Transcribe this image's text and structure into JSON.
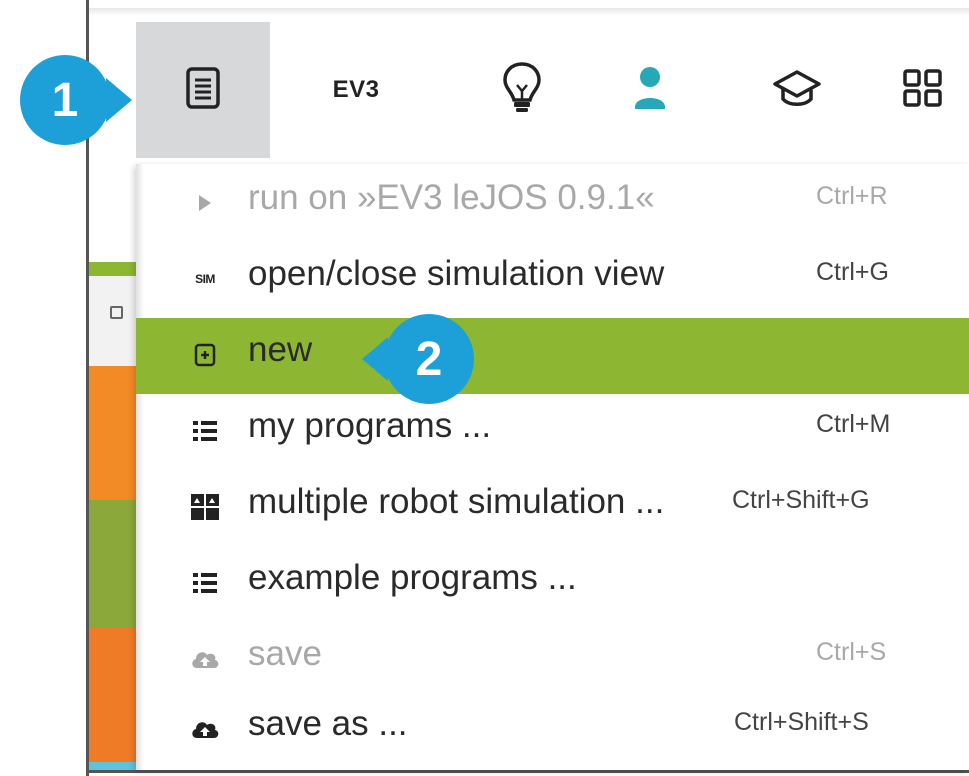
{
  "callouts": {
    "step1": "1",
    "step2": "2"
  },
  "toolbar": {
    "ev3_label": "EV3",
    "icons": [
      "program-menu-icon",
      "lightbulb-icon",
      "user-icon",
      "graduation-cap-icon",
      "grid-icon"
    ]
  },
  "menu": {
    "items": [
      {
        "icon": "play-icon",
        "label": "run on »EV3 leJOS 0.9.1«",
        "shortcut": "Ctrl+R",
        "disabled": true
      },
      {
        "icon": "sim-icon",
        "badge": "SIM",
        "label": "open/close simulation view",
        "shortcut": "Ctrl+G",
        "disabled": false
      },
      {
        "icon": "new-file-icon",
        "label": "new",
        "shortcut": "",
        "disabled": false,
        "highlighted": true
      },
      {
        "icon": "list-icon",
        "label": "my programs ...",
        "shortcut": "Ctrl+M",
        "disabled": false
      },
      {
        "icon": "grid-squares-icon",
        "label": "multiple robot simulation ...",
        "shortcut": "Ctrl+Shift+G",
        "disabled": false
      },
      {
        "icon": "list-icon",
        "label": "example programs ...",
        "shortcut": "",
        "disabled": false
      },
      {
        "icon": "cloud-upload-icon",
        "label": "save",
        "shortcut": "Ctrl+S",
        "disabled": true
      },
      {
        "icon": "cloud-upload-icon",
        "label": "save as ...",
        "shortcut": "Ctrl+Shift+S",
        "disabled": false
      }
    ]
  },
  "colors": {
    "highlight": "#8db733",
    "callout": "#1d9fd8",
    "user_icon": "#26a8b8",
    "active_tab_bg": "#d6d8d9"
  }
}
